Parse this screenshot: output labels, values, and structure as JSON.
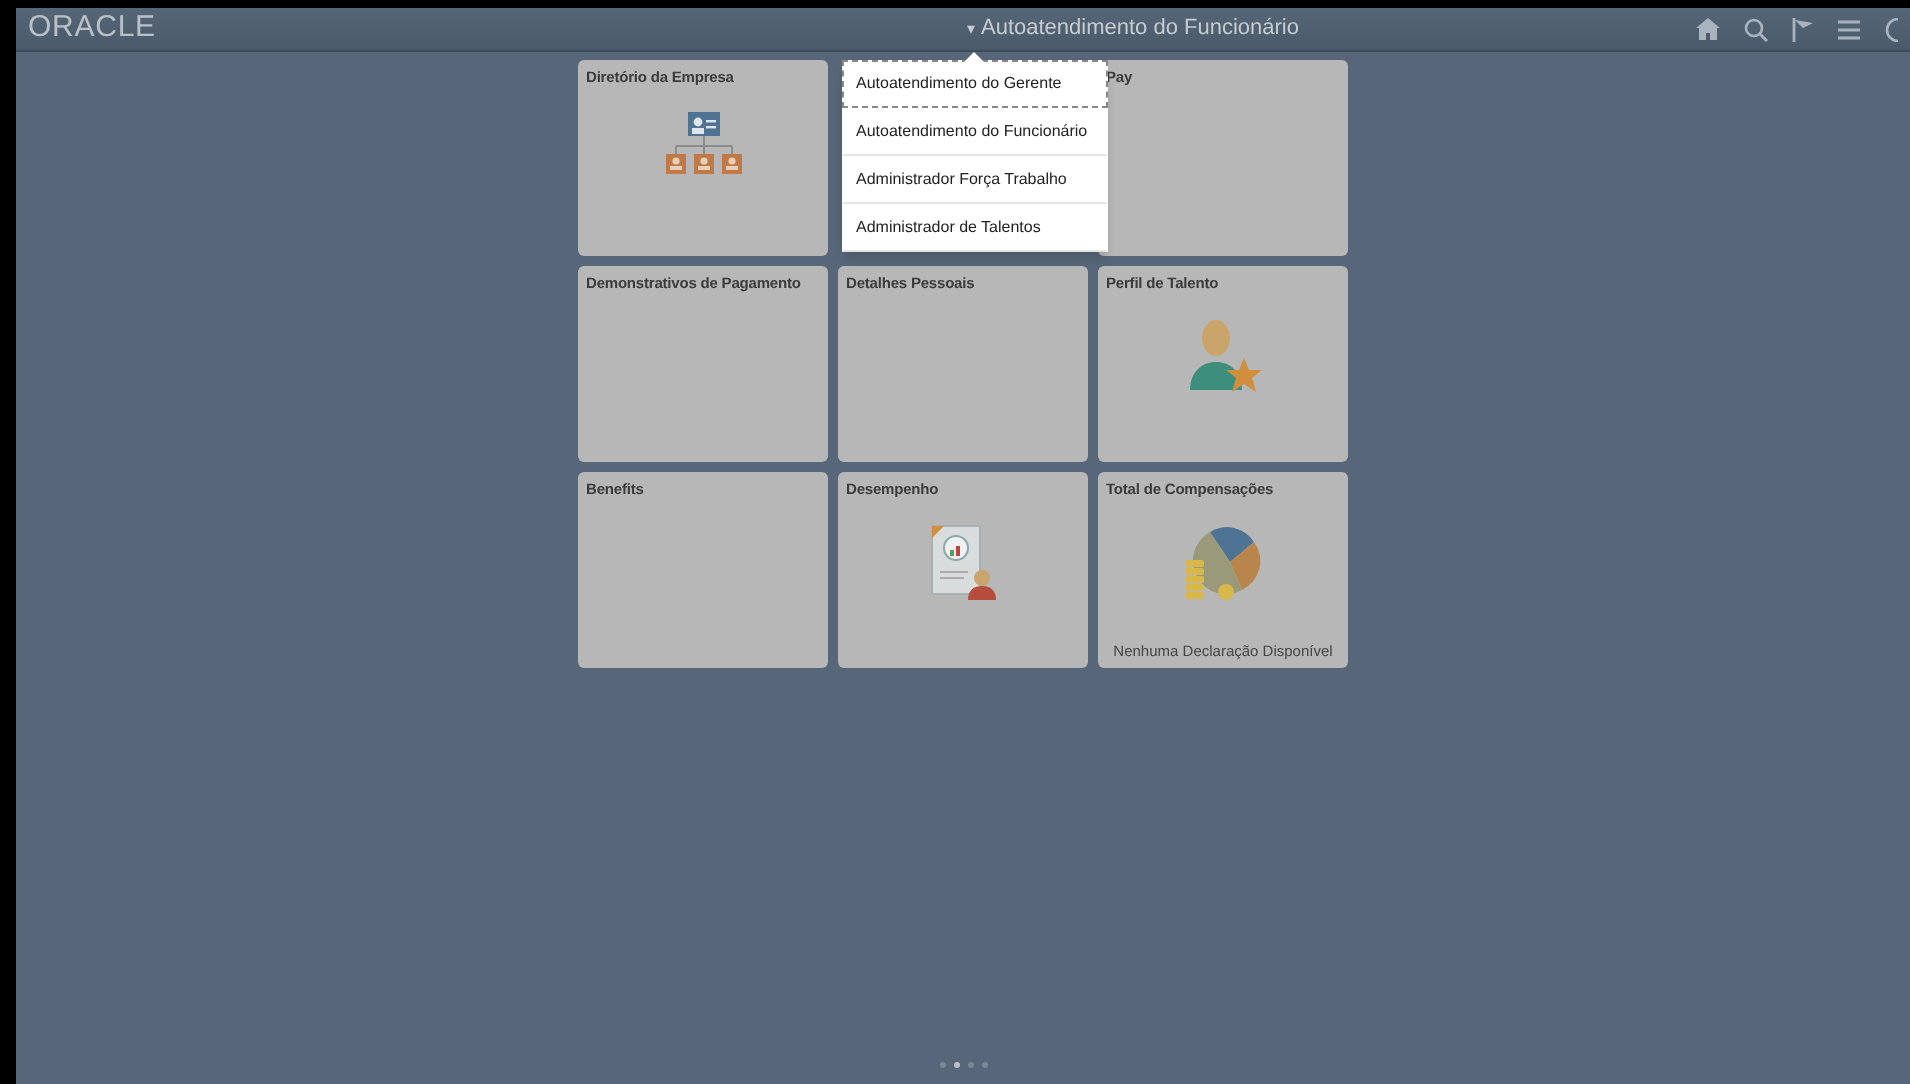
{
  "header": {
    "logo": "ORACLE",
    "title_caret": "▾",
    "title": "Autoatendimento do Funcionário"
  },
  "menu": [
    {
      "label": "Autoatendimento do Gerente",
      "focused": true
    },
    {
      "label": "Autoatendimento do Funcionário",
      "focused": false
    },
    {
      "label": "Administrador Força Trabalho",
      "focused": false
    },
    {
      "label": "Administrador de Talentos",
      "focused": false
    }
  ],
  "tiles": [
    {
      "title": "Diretório da Empresa",
      "kind": "org_chart"
    },
    {
      "kind": "hidden"
    },
    {
      "title": "Pay",
      "kind": "plain"
    },
    {
      "title": "Demonstrativos de Pagamento",
      "kind": "plain"
    },
    {
      "title": "Detalhes Pessoais",
      "kind": "plain"
    },
    {
      "title": "Perfil de Talento",
      "kind": "talent"
    },
    {
      "title": "Benefits",
      "kind": "plain"
    },
    {
      "title": "Desempenho",
      "kind": "performance"
    },
    {
      "title": "Total de Compensações",
      "kind": "compensation",
      "footer": "Nenhuma Declaração Disponível"
    }
  ],
  "pager": [
    {
      "selected": false
    },
    {
      "selected": true
    },
    {
      "selected": false
    },
    {
      "selected": false
    }
  ]
}
